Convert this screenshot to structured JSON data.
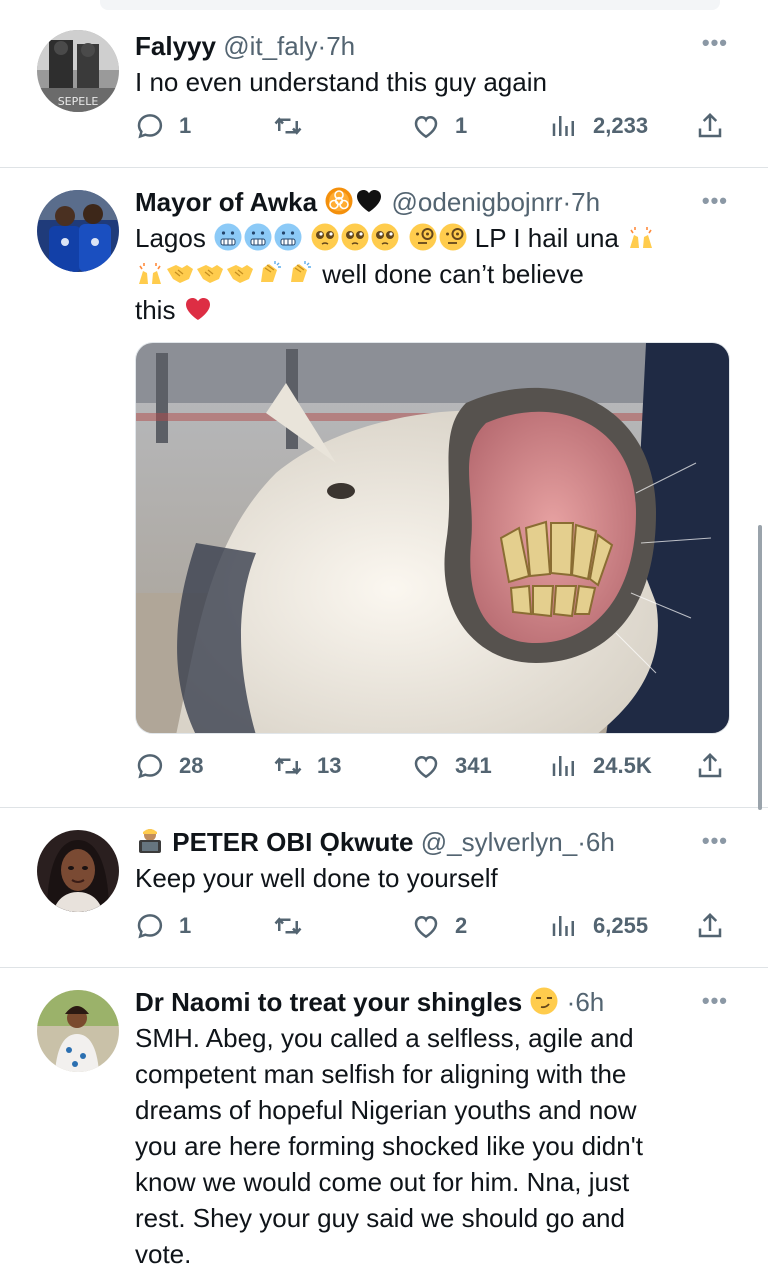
{
  "tweets": [
    {
      "name": "Falyyy",
      "handle": "@it_faly",
      "dot": "·",
      "time": "7h",
      "text": "I no even understand this guy again",
      "avatar_label": "SEPELE",
      "replies": "1",
      "retweets": "",
      "likes": "1",
      "views": "2,233"
    },
    {
      "name": "Mayor of Awka",
      "handle": "@odenigbojnrr",
      "dot": "·",
      "time": "7h",
      "line1_text": "Lagos",
      "line1_tail": "LP I hail una",
      "line2_tail": "well done can’t believe",
      "line3_text": "this",
      "replies": "28",
      "retweets": "13",
      "likes": "341",
      "views": "24.5K"
    },
    {
      "name": "PETER OBI Ọkwute",
      "handle": "@_sylverlyn_",
      "dot": "·",
      "time": "6h",
      "text": "Keep your well done to yourself",
      "replies": "1",
      "retweets": "",
      "likes": "2",
      "views": "6,255"
    },
    {
      "name": "Dr Naomi to treat your shingles",
      "dot": "·",
      "time": "6h",
      "lines": [
        "SMH. Abeg, you called a selfless, agile and",
        "competent man selfish for aligning with the",
        "dreams of hopeful Nigerian youths and now",
        "you are here forming shocked like you didn't",
        "know we would come out for him. Nna, just",
        "rest. Shey your guy said we should go and",
        "vote."
      ]
    }
  ],
  "more_label": "•••",
  "colors": {
    "text": "#0f1419",
    "secondary": "#536471",
    "divider": "#dfe3e6",
    "emoji_yellow": "#ffcc4d"
  },
  "icons": [
    "reply-icon",
    "retweet-icon",
    "like-icon",
    "views-icon",
    "share-icon",
    "more-icon"
  ]
}
